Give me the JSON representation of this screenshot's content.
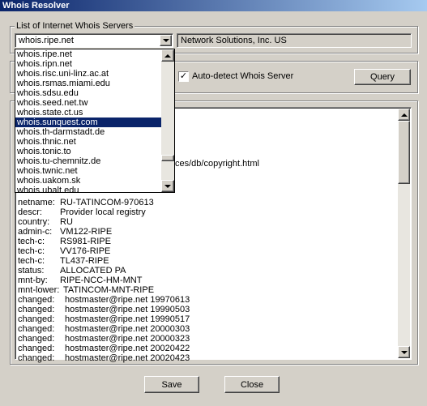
{
  "window": {
    "title": "Whois Resolver"
  },
  "servers_group": {
    "label": "List of Internet Whois Servers",
    "selected_server": "whois.ripe.net",
    "server_description": "Network Solutions, Inc. US",
    "dropdown_items": [
      "whois.ripe.net",
      "whois.ripn.net",
      "whois.risc.uni-linz.ac.at",
      "whois.rsmas.miami.edu",
      "whois.sdsu.edu",
      "whois.seed.net.tw",
      "whois.state.ct.us",
      "whois.sunquest.com",
      "whois.th-darmstadt.de",
      "whois.thnic.net",
      "whois.tonic.to",
      "whois.tu-chemnitz.de",
      "whois.twnic.net",
      "whois.uakom.sk",
      "whois.ubalt.edu"
    ],
    "highlighted_item": "whois.sunquest.com"
  },
  "query_group": {
    "auto_detect_label": "Auto-detect Whois Server",
    "auto_detect_checked": true,
    "query_button": "Query"
  },
  "result": {
    "copyright_fragment": "ces/db/copyright.html",
    "rows": [
      {
        "key": "netname:",
        "value": "RU-TATINCOM-970613"
      },
      {
        "key": "descr:",
        "value": "Provider local registry"
      },
      {
        "key": "country:",
        "value": "RU"
      },
      {
        "key": "admin-c:",
        "value": "VM122-RIPE"
      },
      {
        "key": "tech-c:",
        "value": "RS981-RIPE"
      },
      {
        "key": "tech-c:",
        "value": "VV176-RIPE"
      },
      {
        "key": "tech-c:",
        "value": "TL437-RIPE"
      },
      {
        "key": "status:",
        "value": "ALLOCATED PA"
      },
      {
        "key": "mnt-by:",
        "value": "RIPE-NCC-HM-MNT"
      },
      {
        "key": "mnt-lower:",
        "value": "TATINCOM-MNT-RIPE"
      },
      {
        "key": "changed:",
        "value": "hostmaster@ripe.net 19970613"
      },
      {
        "key": "changed:",
        "value": "hostmaster@ripe.net 19990503"
      },
      {
        "key": "changed:",
        "value": "hostmaster@ripe.net 19990517"
      },
      {
        "key": "changed:",
        "value": "hostmaster@ripe.net 20000303"
      },
      {
        "key": "changed:",
        "value": "hostmaster@ripe.net 20000323"
      },
      {
        "key": "changed:",
        "value": "hostmaster@ripe.net 20020422"
      },
      {
        "key": "changed:",
        "value": "hostmaster@ripe.net 20020423"
      }
    ]
  },
  "footer": {
    "save_button": "Save",
    "close_button": "Close"
  },
  "colors": {
    "titlebar_start": "#0a246a",
    "titlebar_end": "#a6caf0",
    "selection": "#0a246a",
    "face": "#d4d0c8"
  },
  "icons": {
    "dropdown": "chevron-down-icon",
    "scroll_up": "arrow-up-icon",
    "scroll_down": "arrow-down-icon",
    "check": "checkmark-icon"
  }
}
